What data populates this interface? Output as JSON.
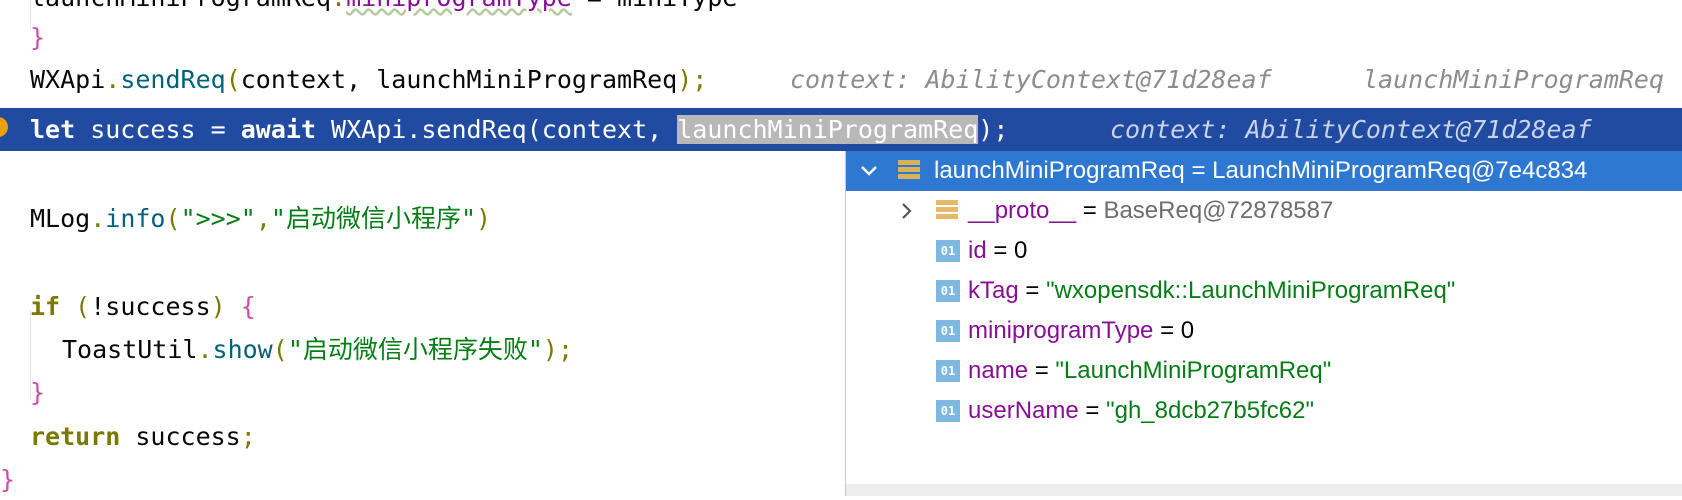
{
  "editor": {
    "line0": {
      "indent": "    ",
      "obj": "launchMiniProgramReq",
      "dot": ".",
      "prop": "miniprogramType",
      "rest": " = miniType"
    },
    "line1": {
      "brace": "}"
    },
    "line2": {
      "obj": "WXApi",
      "dot": ".",
      "fn": "sendReq",
      "open": "(",
      "args": "context, launchMiniProgramReq",
      "close": ");",
      "hint1": "context: AbilityContext@71d28eaf",
      "hint2": "launchMiniProgramReq"
    },
    "line3": {
      "let": "let",
      "before": " success = ",
      "await": "await",
      "call": " WXApi.sendReq(context, ",
      "selected": "launchMiniProgramReq",
      "after": ");",
      "hint": "context: AbilityContext@71d28eaf"
    },
    "line5": {
      "obj": "MLog",
      "dot": ".",
      "fn": "info",
      "open": "(",
      "s1": "\">>>\"",
      "comma": ",",
      "s2": "\"启动微信小程序\"",
      "close": ")"
    },
    "line7": {
      "kw": "if",
      "open": " (",
      "expr": "!success",
      "close": ") ",
      "brace": "{"
    },
    "line8": {
      "obj": "ToastUtil",
      "dot": ".",
      "fn": "show",
      "open": "(",
      "s": "\"启动微信小程序失败\"",
      "close": ");"
    },
    "line9": {
      "brace": "}"
    },
    "line10": {
      "kw": "return",
      "rest": " success",
      "semi": ";"
    },
    "line11": {
      "brace": "}"
    }
  },
  "debug_popup": {
    "header": "launchMiniProgramReq = LaunchMiniProgramReq@7e4c834",
    "items": [
      {
        "name": "__proto__",
        "eq": " = ",
        "value": "BaseReq@72878587",
        "type": "object"
      },
      {
        "name": "id",
        "eq": " = ",
        "value": "0",
        "type": "number"
      },
      {
        "name": "kTag",
        "eq": " = ",
        "value": "\"wxopensdk::LaunchMiniProgramReq\"",
        "type": "string"
      },
      {
        "name": "miniprogramType",
        "eq": " = ",
        "value": "0",
        "type": "number"
      },
      {
        "name": "name",
        "eq": " = ",
        "value": "\"LaunchMiniProgramReq\"",
        "type": "string"
      },
      {
        "name": "userName",
        "eq": " = ",
        "value": "\"gh_8dcb27b5fc62\"",
        "type": "string"
      }
    ],
    "primitive_icon_text": "01"
  },
  "colors": {
    "selection_line": "#214ba1",
    "popup_header": "#2f78d1",
    "breakpoint": "#e9a200",
    "string": "#067d17",
    "field": "#871094"
  }
}
